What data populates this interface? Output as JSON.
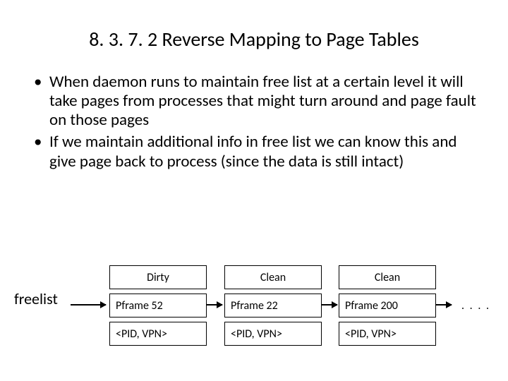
{
  "title": "8. 3. 7. 2 Reverse Mapping to Page Tables",
  "bullets": [
    "When daemon runs to maintain free list at a certain level it will take pages from processes that might turn around and page fault on those pages",
    "If we maintain additional info in free list we can know this and give page back to process (since the data is still intact)"
  ],
  "diagram": {
    "label": "freelist",
    "nodes": [
      {
        "status": "Dirty",
        "pframe": "Pframe 52",
        "pair": "<PID, VPN>"
      },
      {
        "status": "Clean",
        "pframe": "Pframe 22",
        "pair": "<PID, VPN>"
      },
      {
        "status": "Clean",
        "pframe": "Pframe 200",
        "pair": "<PID, VPN>"
      }
    ],
    "ellipsis": ". . . ."
  }
}
